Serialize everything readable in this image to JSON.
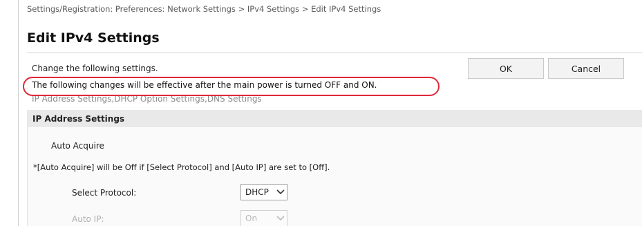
{
  "breadcrumb": "Settings/Registration: Preferences: Network Settings > IPv4 Settings > Edit IPv4 Settings",
  "page_title": "Edit IPv4 Settings",
  "intro_text": "Change the following settings.",
  "notice_text": "The following changes will be effective after the main power is turned OFF and ON.",
  "affected_settings": "IP Address Settings,DHCP Option Settings,DNS Settings",
  "buttons": {
    "ok_label": "OK",
    "cancel_label": "Cancel"
  },
  "section": {
    "title": "IP Address Settings",
    "auto_acquire_label": "Auto Acquire",
    "auto_acquire_note": "*[Auto Acquire] will be Off if [Select Protocol] and [Auto IP] are set to [Off].",
    "fields": {
      "select_protocol": {
        "label": "Select Protocol:",
        "value": "DHCP",
        "enabled": true
      },
      "auto_ip": {
        "label": "Auto IP:",
        "value": "On",
        "enabled": false
      }
    }
  },
  "colors": {
    "highlight_ring": "#e0283a",
    "section_header_bg": "#e9e9e9",
    "disabled_text": "#b0b0b0"
  },
  "icons": {
    "dropdown": "chevron-down-icon"
  }
}
